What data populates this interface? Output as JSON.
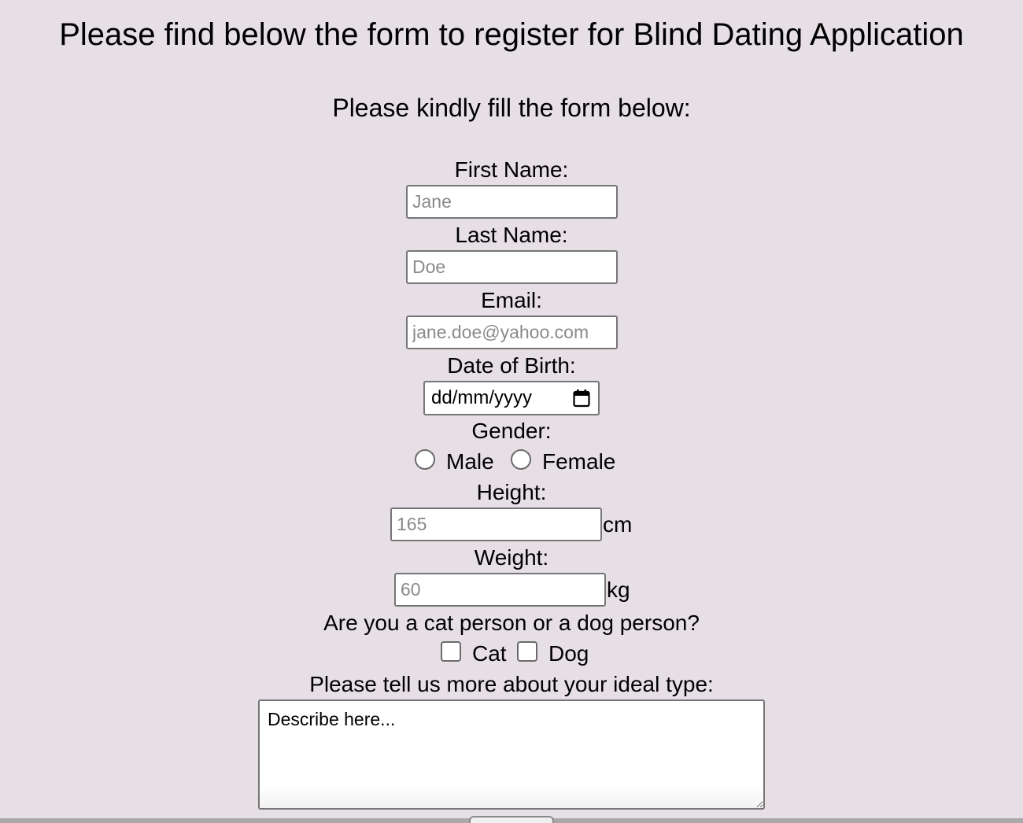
{
  "title": "Please find below the form to register for Blind Dating Application",
  "subtitle": "Please kindly fill the form below:",
  "form": {
    "first_name": {
      "label": "First Name:",
      "placeholder": "Jane"
    },
    "last_name": {
      "label": "Last Name:",
      "placeholder": "Doe"
    },
    "email": {
      "label": "Email:",
      "placeholder": "jane.doe@yahoo.com"
    },
    "dob": {
      "label": "Date of Birth:",
      "format_text": "dd/mm/yyyy"
    },
    "gender": {
      "label": "Gender:",
      "options": [
        "Male",
        "Female"
      ]
    },
    "height": {
      "label": "Height:",
      "placeholder": "165",
      "unit": "cm"
    },
    "weight": {
      "label": "Weight:",
      "placeholder": "60",
      "unit": "kg"
    },
    "pet": {
      "label": "Are you a cat person or a dog person?",
      "options": [
        "Cat",
        "Dog"
      ]
    },
    "ideal_type": {
      "label": "Please tell us more about your ideal type:",
      "placeholder": "Describe here..."
    }
  },
  "colors": {
    "background": "#e6dfe6",
    "input_border": "#767676",
    "placeholder": "#8a8a8a"
  },
  "icons": {
    "calendar": "calendar-icon",
    "resize": "resize-handle-icon"
  }
}
